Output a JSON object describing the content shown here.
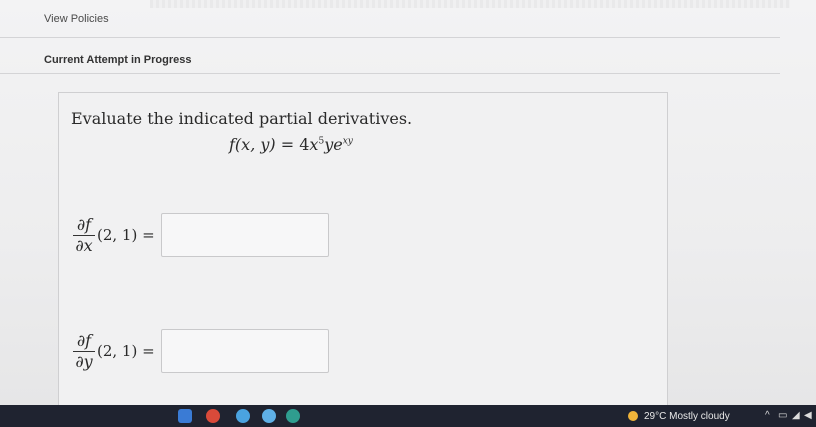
{
  "header": {
    "view_policies": "View Policies",
    "attempt_status": "Current Attempt in Progress"
  },
  "question": {
    "prompt": "Evaluate the indicated partial derivatives.",
    "function_lhs": "f(x, y)",
    "equals": "=",
    "coef": "4",
    "x_var": "x",
    "x_exp": "5",
    "y_var": "y",
    "e_base": "e",
    "e_exp": "xy",
    "parts": [
      {
        "numerator": "∂f",
        "denominator": "∂x",
        "args": "(2, 1) =",
        "value": ""
      },
      {
        "numerator": "∂f",
        "denominator": "∂y",
        "args": "(2, 1) =",
        "value": ""
      }
    ]
  },
  "taskbar": {
    "weather": "29°C  Mostly cloudy",
    "tray_icons": [
      "chevron-up-icon",
      "battery-icon",
      "network-icon",
      "volume-icon"
    ]
  }
}
